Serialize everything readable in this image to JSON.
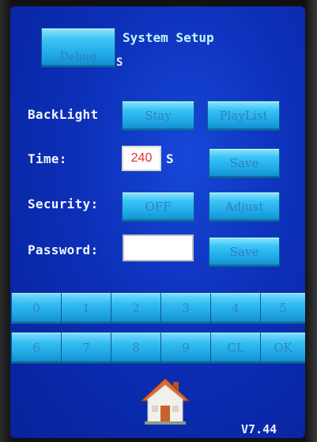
{
  "header": {
    "title": "System Setup",
    "debug_label": "Debug",
    "debug_suffix": "S"
  },
  "backlight": {
    "label": "BackLight",
    "stay_label": "Stay",
    "playlist_label": "PlayList"
  },
  "time": {
    "label": "Time:",
    "value": "240",
    "unit": "S",
    "save_label": "Save"
  },
  "security": {
    "label": "Security:",
    "state_label": "OFF",
    "adjust_label": "Adjust"
  },
  "password": {
    "label": "Password:",
    "value": "",
    "save_label": "Save"
  },
  "keypad": {
    "row1": [
      "0",
      "1",
      "2",
      "3",
      "4",
      "5"
    ],
    "row2": [
      "6",
      "7",
      "8",
      "9",
      "CL",
      "OK"
    ]
  },
  "footer": {
    "version": "V7.44",
    "home_icon": "home-icon"
  },
  "colors": {
    "screen_bg": "#0c2fb8",
    "button": "#39c3f5",
    "time_value": "#e0303a",
    "title": "#c7f5ff"
  }
}
